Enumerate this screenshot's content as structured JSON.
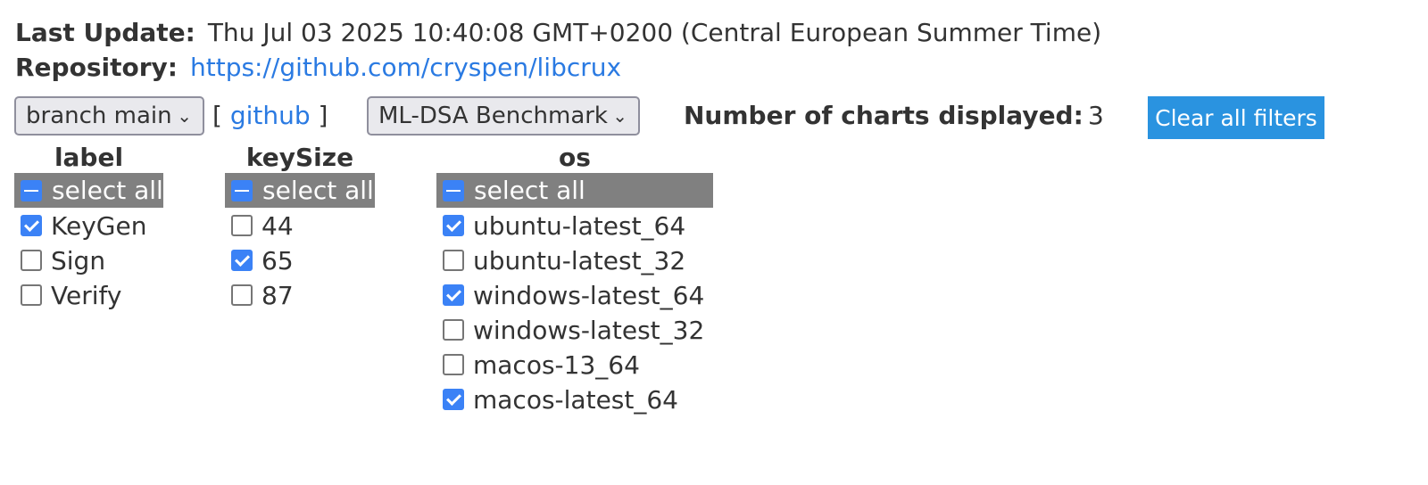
{
  "header": {
    "last_update_label": "Last Update:",
    "last_update_value": "Thu Jul 03 2025 10:40:08 GMT+0200 (Central European Summer Time)",
    "repository_label": "Repository:",
    "repository_url": "https://github.com/cryspen/libcrux"
  },
  "controls": {
    "branch_select": "branch main",
    "github_open": "[",
    "github_link": "github",
    "github_close": "]",
    "benchmark_select": "ML-DSA Benchmark",
    "charts_label": "Number of charts displayed:",
    "charts_count": "3",
    "clear_button": "Clear all filters"
  },
  "filters": {
    "label": {
      "header": "label",
      "select_all": "select all",
      "options": [
        {
          "text": "KeyGen",
          "checked": true
        },
        {
          "text": "Sign",
          "checked": false
        },
        {
          "text": "Verify",
          "checked": false
        }
      ]
    },
    "keySize": {
      "header": "keySize",
      "select_all": "select all",
      "options": [
        {
          "text": "44",
          "checked": false
        },
        {
          "text": "65",
          "checked": true
        },
        {
          "text": "87",
          "checked": false
        }
      ]
    },
    "os": {
      "header": "os",
      "select_all": "select all",
      "options": [
        {
          "text": "ubuntu-latest_64",
          "checked": true
        },
        {
          "text": "ubuntu-latest_32",
          "checked": false
        },
        {
          "text": "windows-latest_64",
          "checked": true
        },
        {
          "text": "windows-latest_32",
          "checked": false
        },
        {
          "text": "macos-13_64",
          "checked": false
        },
        {
          "text": "macos-latest_64",
          "checked": true
        }
      ]
    }
  },
  "colors": {
    "accent": "#2a93e0",
    "link": "#2a7ae2",
    "checkbox": "#3b82f6",
    "select_all_bg": "#808080"
  },
  "icons": {
    "dropdown": "chevron-down-icon"
  }
}
